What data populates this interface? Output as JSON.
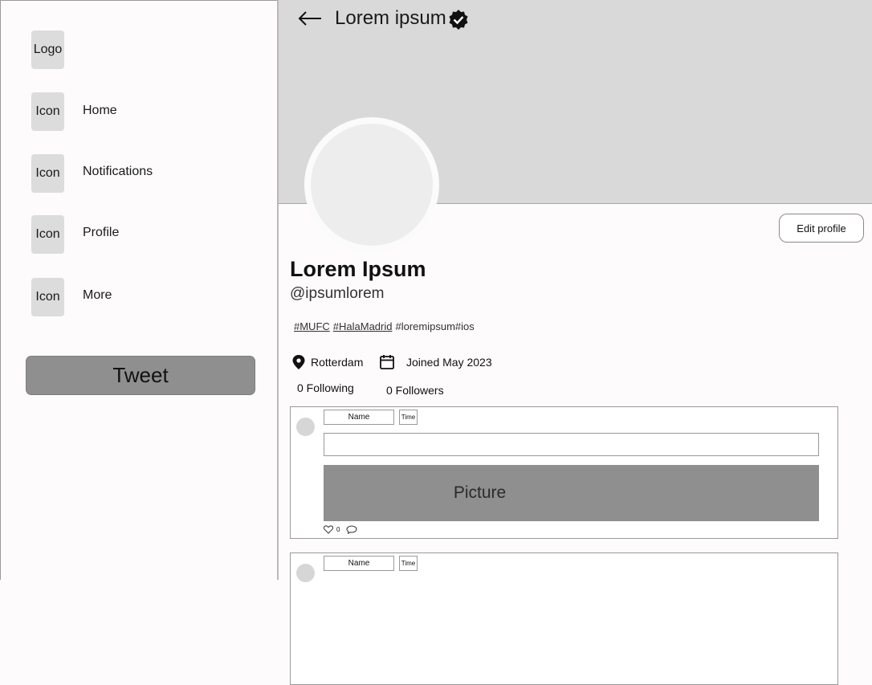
{
  "sidebar": {
    "logo_label": "Logo",
    "items": [
      {
        "icon_label": "Icon",
        "label": "Home"
      },
      {
        "icon_label": "Icon",
        "label": "Notifications"
      },
      {
        "icon_label": "Icon",
        "label": "Profile"
      },
      {
        "icon_label": "Icon",
        "label": "More"
      }
    ],
    "tweet_button": "Tweet"
  },
  "header": {
    "back_icon": "arrow-left-icon",
    "title": "Lorem ipsum",
    "verified_icon": "verified-badge-icon"
  },
  "profile": {
    "edit_button": "Edit profile",
    "display_name": "Lorem Ipsum",
    "handle": "@ipsumlorem",
    "hashtags": [
      "#MUFC",
      "#HalaMadrid",
      "#loremipsum#ios"
    ],
    "location": "Rotterdam",
    "joined": "Joined May 2023",
    "following": "0 Following",
    "followers": "0 Followers"
  },
  "tweets": [
    {
      "name": "Name",
      "time": "Time",
      "picture_label": "Picture",
      "like_count": "0"
    },
    {
      "name": "Name",
      "time": "Time"
    }
  ],
  "colors": {
    "banner": "#d9d9d9",
    "tweet_button": "#8f8f8f",
    "picture": "#8f8f8f",
    "icon_placeholder": "#dcdcdc"
  }
}
